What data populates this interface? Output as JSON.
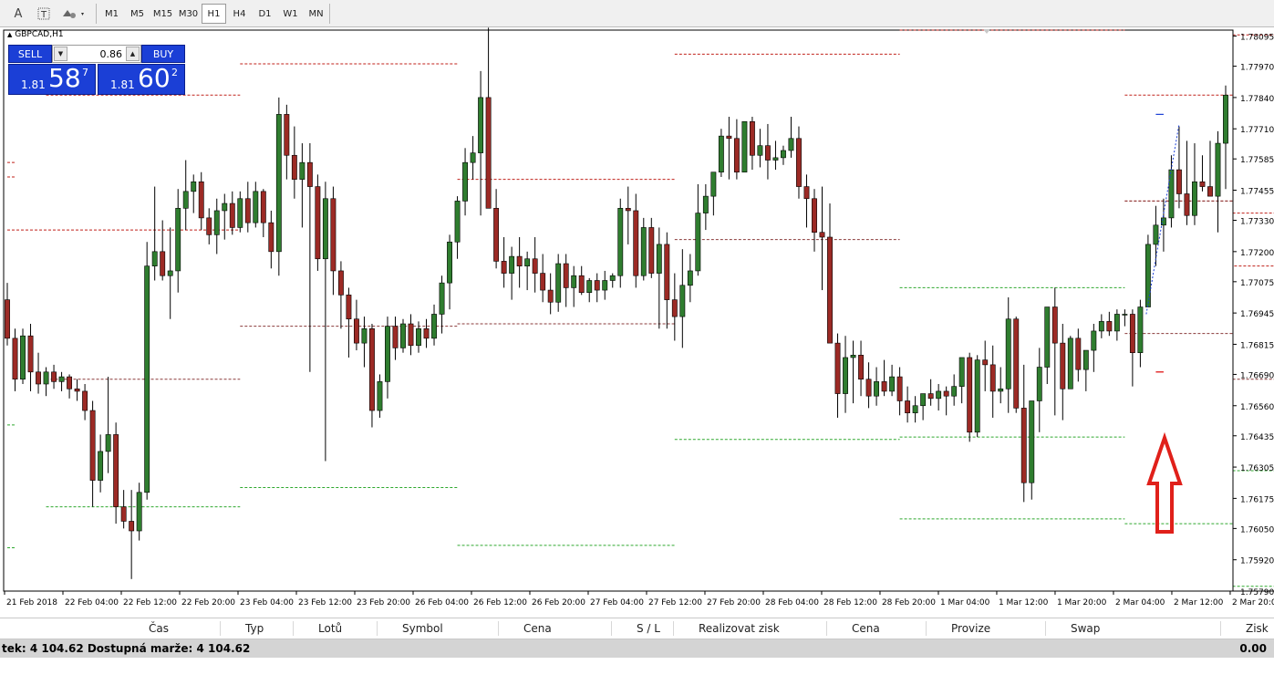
{
  "toolbar": {
    "icons": [
      "text-icon",
      "text-label-icon",
      "shapes-icon"
    ],
    "timeframes": [
      {
        "label": "M1",
        "active": false
      },
      {
        "label": "M5",
        "active": false
      },
      {
        "label": "M15",
        "active": false
      },
      {
        "label": "M30",
        "active": false
      },
      {
        "label": "H1",
        "active": true
      },
      {
        "label": "H4",
        "active": false
      },
      {
        "label": "D1",
        "active": false
      },
      {
        "label": "W1",
        "active": false
      },
      {
        "label": "MN",
        "active": false
      }
    ]
  },
  "chart": {
    "symbol": "GBPCAD,H1",
    "up_color": "#2f7d2f",
    "down_color": "#9c2a25",
    "resistance_color": "#c0201a",
    "support_color": "#2ea82e",
    "arrow_color": "#e0201a"
  },
  "trade_panel": {
    "sell_label": "SELL",
    "buy_label": "BUY",
    "lot_value": "0.86",
    "sell_price": {
      "prefix": "1.81",
      "big": "58",
      "sup": "7"
    },
    "buy_price": {
      "prefix": "1.81",
      "big": "60",
      "sup": "2"
    }
  },
  "chart_data": {
    "type": "candlestick",
    "price_ticks": [
      "1.78095",
      "1.77970",
      "1.77840",
      "1.77710",
      "1.77585",
      "1.77455",
      "1.77330",
      "1.77200",
      "1.77075",
      "1.76945",
      "1.76815",
      "1.76690",
      "1.76560",
      "1.76435",
      "1.76305",
      "1.76175",
      "1.76050",
      "1.75920",
      "1.75790"
    ],
    "time_ticks": [
      "21 Feb 2018",
      "22 Feb 04:00",
      "22 Feb 12:00",
      "22 Feb 20:00",
      "23 Feb 04:00",
      "23 Feb 12:00",
      "23 Feb 20:00",
      "26 Feb 04:00",
      "26 Feb 12:00",
      "26 Feb 20:00",
      "27 Feb 04:00",
      "27 Feb 12:00",
      "27 Feb 20:00",
      "28 Feb 04:00",
      "28 Feb 12:00",
      "28 Feb 20:00",
      "1 Mar 04:00",
      "1 Mar 12:00",
      "1 Mar 20:00",
      "2 Mar 04:00",
      "2 Mar 12:00",
      "2 Mar 20:00"
    ],
    "ylim": [
      1.7579,
      1.7812
    ],
    "candles": [
      [
        1.77,
        1.7707,
        1.7681,
        1.7684
      ],
      [
        1.7684,
        1.7688,
        1.7662,
        1.7667
      ],
      [
        1.7667,
        1.7688,
        1.7665,
        1.7685
      ],
      [
        1.7685,
        1.769,
        1.7662,
        1.767
      ],
      [
        1.767,
        1.7678,
        1.7661,
        1.7665
      ],
      [
        1.7665,
        1.7672,
        1.766,
        1.767
      ],
      [
        1.767,
        1.7673,
        1.7663,
        1.7666
      ],
      [
        1.7666,
        1.767,
        1.7662,
        1.7668
      ],
      [
        1.7668,
        1.7669,
        1.7659,
        1.7663
      ],
      [
        1.7663,
        1.7667,
        1.7658,
        1.7662
      ],
      [
        1.7662,
        1.7665,
        1.765,
        1.7654
      ],
      [
        1.7654,
        1.7658,
        1.7614,
        1.7625
      ],
      [
        1.7625,
        1.7644,
        1.762,
        1.7637
      ],
      [
        1.7637,
        1.7668,
        1.7628,
        1.7644
      ],
      [
        1.7644,
        1.7649,
        1.7607,
        1.7614
      ],
      [
        1.7614,
        1.7621,
        1.7605,
        1.7608
      ],
      [
        1.7608,
        1.7621,
        1.7584,
        1.7604
      ],
      [
        1.7604,
        1.7624,
        1.76,
        1.762
      ],
      [
        1.762,
        1.7724,
        1.7617,
        1.7714
      ],
      [
        1.7714,
        1.7747,
        1.7708,
        1.772
      ],
      [
        1.772,
        1.7733,
        1.7708,
        1.771
      ],
      [
        1.771,
        1.773,
        1.7692,
        1.7712
      ],
      [
        1.7712,
        1.7746,
        1.7703,
        1.7738
      ],
      [
        1.7738,
        1.7758,
        1.7729,
        1.7745
      ],
      [
        1.7745,
        1.7752,
        1.7736,
        1.7749
      ],
      [
        1.7749,
        1.7753,
        1.7729,
        1.7734
      ],
      [
        1.7734,
        1.7738,
        1.7723,
        1.7727
      ],
      [
        1.7727,
        1.7742,
        1.7719,
        1.7737
      ],
      [
        1.7737,
        1.7744,
        1.7725,
        1.774
      ],
      [
        1.774,
        1.7745,
        1.7727,
        1.773
      ],
      [
        1.773,
        1.7745,
        1.7728,
        1.7742
      ],
      [
        1.7742,
        1.7749,
        1.7728,
        1.7732
      ],
      [
        1.7732,
        1.7749,
        1.773,
        1.7745
      ],
      [
        1.7745,
        1.7746,
        1.7726,
        1.7732
      ],
      [
        1.7732,
        1.7737,
        1.7713,
        1.772
      ],
      [
        1.772,
        1.7784,
        1.771,
        1.7777
      ],
      [
        1.7777,
        1.7781,
        1.775,
        1.776
      ],
      [
        1.776,
        1.7772,
        1.7742,
        1.775
      ],
      [
        1.775,
        1.7765,
        1.773,
        1.7757
      ],
      [
        1.7757,
        1.7765,
        1.767,
        1.7747
      ],
      [
        1.7747,
        1.7752,
        1.7712,
        1.7717
      ],
      [
        1.7717,
        1.7749,
        1.7633,
        1.7742
      ],
      [
        1.7742,
        1.7747,
        1.7702,
        1.7712
      ],
      [
        1.7712,
        1.7716,
        1.7688,
        1.7702
      ],
      [
        1.7702,
        1.7705,
        1.7676,
        1.7692
      ],
      [
        1.7692,
        1.77,
        1.7679,
        1.7682
      ],
      [
        1.7682,
        1.7693,
        1.7672,
        1.7688
      ],
      [
        1.7688,
        1.769,
        1.7647,
        1.7654
      ],
      [
        1.7654,
        1.7669,
        1.7651,
        1.7666
      ],
      [
        1.7666,
        1.7693,
        1.7659,
        1.7689
      ],
      [
        1.7689,
        1.7693,
        1.7675,
        1.768
      ],
      [
        1.768,
        1.7692,
        1.7678,
        1.769
      ],
      [
        1.769,
        1.7694,
        1.7677,
        1.7681
      ],
      [
        1.7681,
        1.7691,
        1.7678,
        1.7688
      ],
      [
        1.7688,
        1.7692,
        1.768,
        1.7684
      ],
      [
        1.7684,
        1.7698,
        1.7681,
        1.7694
      ],
      [
        1.7694,
        1.771,
        1.7686,
        1.7707
      ],
      [
        1.7707,
        1.7727,
        1.7696,
        1.7724
      ],
      [
        1.7724,
        1.7743,
        1.7717,
        1.7741
      ],
      [
        1.7741,
        1.7763,
        1.7735,
        1.7757
      ],
      [
        1.7757,
        1.7768,
        1.775,
        1.7761
      ],
      [
        1.7761,
        1.7795,
        1.7735,
        1.7784
      ],
      [
        1.7784,
        1.7813,
        1.7749,
        1.7738
      ],
      [
        1.7738,
        1.7746,
        1.7713,
        1.7716
      ],
      [
        1.7716,
        1.7726,
        1.7705,
        1.7711
      ],
      [
        1.7711,
        1.7722,
        1.77,
        1.7718
      ],
      [
        1.7718,
        1.7726,
        1.7705,
        1.7714
      ],
      [
        1.7714,
        1.772,
        1.7704,
        1.7717
      ],
      [
        1.7717,
        1.7726,
        1.7703,
        1.7711
      ],
      [
        1.7711,
        1.7719,
        1.7699,
        1.7704
      ],
      [
        1.7704,
        1.7711,
        1.7694,
        1.7699
      ],
      [
        1.7699,
        1.7719,
        1.7695,
        1.7715
      ],
      [
        1.7715,
        1.7719,
        1.7697,
        1.7705
      ],
      [
        1.7705,
        1.7714,
        1.7697,
        1.771
      ],
      [
        1.771,
        1.7714,
        1.7702,
        1.7703
      ],
      [
        1.7703,
        1.7709,
        1.7699,
        1.7708
      ],
      [
        1.7708,
        1.7711,
        1.7699,
        1.7704
      ],
      [
        1.7704,
        1.7712,
        1.77,
        1.7708
      ],
      [
        1.7708,
        1.7711,
        1.7705,
        1.771
      ],
      [
        1.771,
        1.7742,
        1.7705,
        1.7738
      ],
      [
        1.7738,
        1.7747,
        1.7723,
        1.7737
      ],
      [
        1.7737,
        1.7744,
        1.7705,
        1.771
      ],
      [
        1.771,
        1.7734,
        1.7708,
        1.773
      ],
      [
        1.773,
        1.7734,
        1.7709,
        1.7711
      ],
      [
        1.7711,
        1.773,
        1.7688,
        1.7723
      ],
      [
        1.7723,
        1.7728,
        1.7688,
        1.77
      ],
      [
        1.77,
        1.7711,
        1.7683,
        1.7693
      ],
      [
        1.7693,
        1.7721,
        1.768,
        1.7706
      ],
      [
        1.7706,
        1.7719,
        1.7699,
        1.7712
      ],
      [
        1.7712,
        1.7748,
        1.771,
        1.7736
      ],
      [
        1.7736,
        1.7748,
        1.7729,
        1.7743
      ],
      [
        1.7743,
        1.7752,
        1.7735,
        1.7753
      ],
      [
        1.7753,
        1.7771,
        1.7751,
        1.7768
      ],
      [
        1.7768,
        1.7776,
        1.775,
        1.7767
      ],
      [
        1.7767,
        1.7775,
        1.775,
        1.7753
      ],
      [
        1.7753,
        1.7768,
        1.776,
        1.7774
      ],
      [
        1.7774,
        1.7776,
        1.7754,
        1.776
      ],
      [
        1.776,
        1.7771,
        1.7755,
        1.7764
      ],
      [
        1.7764,
        1.7773,
        1.775,
        1.7758
      ],
      [
        1.7758,
        1.7766,
        1.7754,
        1.7759
      ],
      [
        1.7759,
        1.7764,
        1.7756,
        1.7762
      ],
      [
        1.7762,
        1.7776,
        1.7759,
        1.7767
      ],
      [
        1.7767,
        1.7772,
        1.7742,
        1.7747
      ],
      [
        1.7747,
        1.7752,
        1.773,
        1.7742
      ],
      [
        1.7742,
        1.7746,
        1.772,
        1.7728
      ],
      [
        1.7728,
        1.7747,
        1.7704,
        1.7726
      ],
      [
        1.7726,
        1.774,
        1.7694,
        1.7682
      ],
      [
        1.7682,
        1.7686,
        1.7651,
        1.7661
      ],
      [
        1.7661,
        1.7685,
        1.7653,
        1.7676
      ],
      [
        1.7676,
        1.7683,
        1.7657,
        1.7677
      ],
      [
        1.7677,
        1.7683,
        1.766,
        1.7667
      ],
      [
        1.7667,
        1.7674,
        1.7655,
        1.766
      ],
      [
        1.766,
        1.7672,
        1.7656,
        1.7666
      ],
      [
        1.7666,
        1.7675,
        1.766,
        1.7662
      ],
      [
        1.7662,
        1.7673,
        1.766,
        1.7668
      ],
      [
        1.7668,
        1.7672,
        1.7652,
        1.7658
      ],
      [
        1.7658,
        1.7664,
        1.7649,
        1.7653
      ],
      [
        1.7653,
        1.766,
        1.7649,
        1.7656
      ],
      [
        1.7656,
        1.7661,
        1.765,
        1.7661
      ],
      [
        1.7661,
        1.7667,
        1.7656,
        1.7659
      ],
      [
        1.7659,
        1.7665,
        1.7654,
        1.7662
      ],
      [
        1.7662,
        1.7664,
        1.7652,
        1.766
      ],
      [
        1.766,
        1.7669,
        1.7656,
        1.7664
      ],
      [
        1.7664,
        1.7675,
        1.7657,
        1.7676
      ],
      [
        1.7676,
        1.7678,
        1.7641,
        1.7645
      ],
      [
        1.7645,
        1.7677,
        1.7643,
        1.7675
      ],
      [
        1.7675,
        1.7683,
        1.7662,
        1.7673
      ],
      [
        1.7673,
        1.7681,
        1.7651,
        1.7662
      ],
      [
        1.7662,
        1.7672,
        1.7657,
        1.7663
      ],
      [
        1.7663,
        1.7701,
        1.7653,
        1.7692
      ],
      [
        1.7692,
        1.7693,
        1.7653,
        1.7655
      ],
      [
        1.7655,
        1.7673,
        1.7616,
        1.7624
      ],
      [
        1.7624,
        1.7656,
        1.7617,
        1.7658
      ],
      [
        1.7658,
        1.768,
        1.7645,
        1.7672
      ],
      [
        1.7672,
        1.7693,
        1.7665,
        1.7697
      ],
      [
        1.7697,
        1.7705,
        1.7652,
        1.7682
      ],
      [
        1.7682,
        1.769,
        1.765,
        1.7663
      ],
      [
        1.7663,
        1.7685,
        1.7666,
        1.7684
      ],
      [
        1.7684,
        1.7688,
        1.7666,
        1.7671
      ],
      [
        1.7671,
        1.7677,
        1.7662,
        1.7679
      ],
      [
        1.7679,
        1.769,
        1.767,
        1.7687
      ],
      [
        1.7687,
        1.7694,
        1.7684,
        1.7691
      ],
      [
        1.7691,
        1.7695,
        1.7685,
        1.7687
      ],
      [
        1.7687,
        1.7696,
        1.7683,
        1.7694
      ],
      [
        1.7694,
        1.7696,
        1.7689,
        1.7694
      ],
      [
        1.7694,
        1.7696,
        1.7664,
        1.7678
      ],
      [
        1.7678,
        1.77,
        1.7672,
        1.7697
      ],
      [
        1.7697,
        1.7727,
        1.7699,
        1.7723
      ],
      [
        1.7723,
        1.7739,
        1.7714,
        1.7731
      ],
      [
        1.7731,
        1.7742,
        1.772,
        1.7734
      ],
      [
        1.7734,
        1.776,
        1.773,
        1.7754
      ],
      [
        1.7754,
        1.7772,
        1.7738,
        1.7744
      ],
      [
        1.7744,
        1.7766,
        1.7731,
        1.7735
      ],
      [
        1.7735,
        1.7765,
        1.7731,
        1.7749
      ],
      [
        1.7749,
        1.776,
        1.7745,
        1.7747
      ],
      [
        1.7747,
        1.7766,
        1.7744,
        1.7743
      ],
      [
        1.7743,
        1.777,
        1.7728,
        1.7765
      ],
      [
        1.7765,
        1.7789,
        1.7746,
        1.7785
      ]
    ],
    "levels": {
      "resistance": [
        {
          "from": 0,
          "to": 1,
          "price": 1.7757
        },
        {
          "from": 5,
          "to": 30,
          "price": 1.7785
        },
        {
          "from": 30,
          "to": 58,
          "price": 1.7798
        },
        {
          "from": 86,
          "to": 115,
          "price": 1.7802
        },
        {
          "from": 115,
          "to": 144,
          "price": 1.7812
        },
        {
          "from": 144,
          "to": 170,
          "price": 1.7785
        },
        {
          "from": 170,
          "to": 204,
          "price": 1.781
        },
        {
          "from": 0,
          "to": 1,
          "price": 1.7751
        },
        {
          "from": 0,
          "to": 30,
          "price": 1.7729
        },
        {
          "from": 58,
          "to": 86,
          "price": 1.775
        },
        {
          "from": 144,
          "to": 170,
          "price": 1.7741
        },
        {
          "from": 170,
          "to": 199,
          "price": 1.7736
        },
        {
          "from": 199,
          "to": 228,
          "price": 1.7714
        }
      ],
      "neutral": [
        {
          "from": 5,
          "to": 30,
          "price": 1.7667
        },
        {
          "from": 30,
          "to": 58,
          "price": 1.7689
        },
        {
          "from": 58,
          "to": 86,
          "price": 1.769
        },
        {
          "from": 86,
          "to": 115,
          "price": 1.7725
        },
        {
          "from": 144,
          "to": 170,
          "price": 1.7741
        },
        {
          "from": 144,
          "to": 170,
          "price": 1.7686
        },
        {
          "from": 170,
          "to": 199,
          "price": 1.7667
        }
      ],
      "support": [
        {
          "from": 0,
          "to": 1,
          "price": 1.7648
        },
        {
          "from": 5,
          "to": 30,
          "price": 1.7614
        },
        {
          "from": 30,
          "to": 58,
          "price": 1.7622
        },
        {
          "from": 58,
          "to": 86,
          "price": 1.7598
        },
        {
          "from": 86,
          "to": 115,
          "price": 1.7642
        },
        {
          "from": 115,
          "to": 144,
          "price": 1.7705
        },
        {
          "from": 115,
          "to": 144,
          "price": 1.7643
        },
        {
          "from": 115,
          "to": 144,
          "price": 1.7609
        },
        {
          "from": 144,
          "to": 170,
          "price": 1.7607
        },
        {
          "from": 170,
          "to": 199,
          "price": 1.7629
        },
        {
          "from": 170,
          "to": 199,
          "price": 1.7581
        },
        {
          "from": 0,
          "to": 1,
          "price": 1.7597
        }
      ]
    }
  },
  "terminal": {
    "columns": [
      "Čas",
      "Typ",
      "Lotů",
      "Symbol",
      "Cena",
      "S / L",
      "Realizovat zisk",
      "Cena",
      "Provize",
      "Swap",
      "Zisk"
    ],
    "balance_text": "tek: 4 104.62  Dostupná marže: 4 104.62",
    "profit_total": "0.00"
  }
}
